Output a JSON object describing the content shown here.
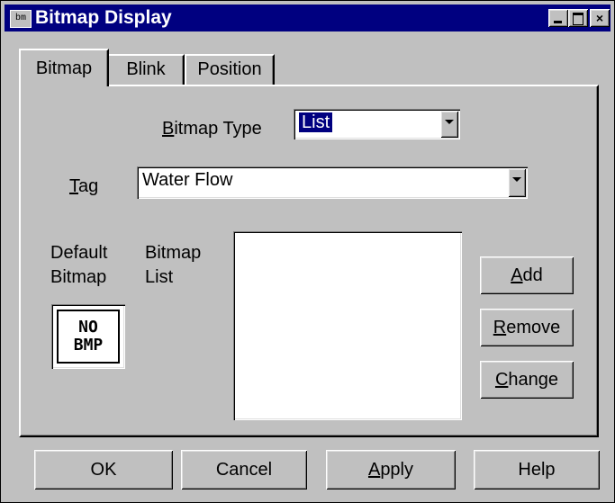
{
  "window": {
    "title": "Bitmap Display",
    "icon": "bitmap-app-icon"
  },
  "tabs": [
    {
      "label": "Bitmap",
      "active": true
    },
    {
      "label": "Blink",
      "active": false
    },
    {
      "label": "Position",
      "active": false
    }
  ],
  "bitmap_type": {
    "label": "Bitmap Type",
    "value": "List"
  },
  "tag": {
    "label": "Tag",
    "value": "Water Flow"
  },
  "default_bitmap": {
    "label_line1": "Default",
    "label_line2": "Bitmap",
    "preview_line1": "NO",
    "preview_line2": "BMP"
  },
  "bitmap_list": {
    "label_line1": "Bitmap",
    "label_line2": "List",
    "items": []
  },
  "list_buttons": {
    "add": "Add",
    "remove": "Remove",
    "change": "Change"
  },
  "footer": {
    "ok": "OK",
    "cancel": "Cancel",
    "apply": "Apply",
    "help": "Help"
  },
  "colors": {
    "titlebar": "#000080",
    "face": "#c0c0c0",
    "field": "#ffffff"
  }
}
